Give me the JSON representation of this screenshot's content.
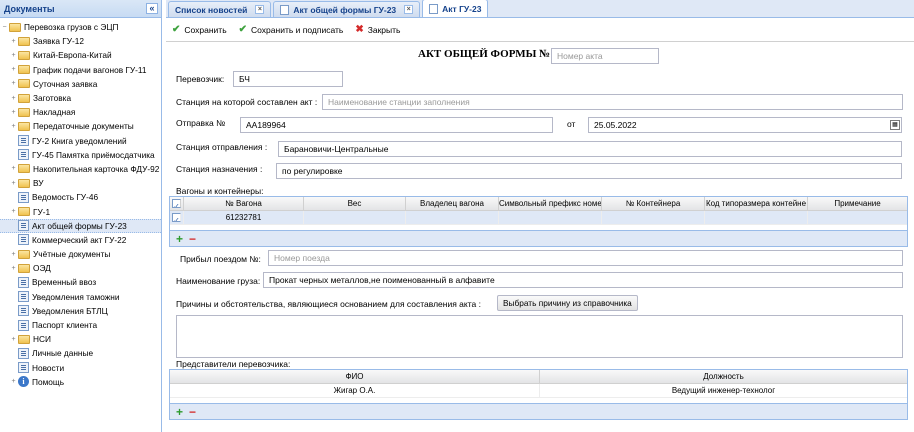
{
  "sidebar": {
    "title": "Документы",
    "collapse": "«",
    "root": "Перевозка грузов с ЭЦП",
    "items": [
      {
        "label": "Заявка ГУ-12",
        "icon": "folder",
        "exp": "+"
      },
      {
        "label": "Китай-Европа-Китай",
        "icon": "folder",
        "exp": "+"
      },
      {
        "label": "График подачи вагонов ГУ-11",
        "icon": "folder",
        "exp": "+"
      },
      {
        "label": "Суточная заявка",
        "icon": "folder",
        "exp": "+"
      },
      {
        "label": "Заготовка",
        "icon": "folder",
        "exp": "+"
      },
      {
        "label": "Накладная",
        "icon": "folder",
        "exp": "+"
      },
      {
        "label": "Передаточные документы",
        "icon": "folder",
        "exp": "+"
      },
      {
        "label": "ГУ-2 Книга уведомлений",
        "icon": "doc",
        "exp": ""
      },
      {
        "label": "ГУ-45 Памятка приёмосдатчика",
        "icon": "doc",
        "exp": ""
      },
      {
        "label": "Накопительная карточка ФДУ-92",
        "icon": "folder",
        "exp": "+"
      },
      {
        "label": "ВУ",
        "icon": "folder",
        "exp": "+"
      },
      {
        "label": "Ведомость ГУ-46",
        "icon": "doc",
        "exp": ""
      },
      {
        "label": "ГУ-1",
        "icon": "folder",
        "exp": "+"
      },
      {
        "label": "Акт общей формы ГУ-23",
        "icon": "doc",
        "exp": "",
        "selected": true
      },
      {
        "label": "Коммерческий акт ГУ-22",
        "icon": "doc",
        "exp": ""
      },
      {
        "label": "Учётные документы",
        "icon": "folder",
        "exp": "+"
      },
      {
        "label": "ОЭД",
        "icon": "folder",
        "exp": "+"
      },
      {
        "label": "Временный ввоз",
        "icon": "doc",
        "exp": ""
      },
      {
        "label": "Уведомления таможни",
        "icon": "doc",
        "exp": ""
      },
      {
        "label": "Уведомления БТЛЦ",
        "icon": "doc",
        "exp": ""
      },
      {
        "label": "Паспорт клиента",
        "icon": "doc",
        "exp": ""
      },
      {
        "label": "НСИ",
        "icon": "folder",
        "exp": "+"
      },
      {
        "label": "Личные данные",
        "icon": "doc",
        "exp": ""
      },
      {
        "label": "Новости",
        "icon": "doc",
        "exp": ""
      }
    ],
    "help": "Помощь"
  },
  "tabs": [
    {
      "label": "Список новостей",
      "active": false
    },
    {
      "label": "Акт общей формы ГУ-23",
      "active": false
    },
    {
      "label": "Акт ГУ-23",
      "active": true
    }
  ],
  "toolbar": {
    "save": "Сохранить",
    "save_sign": "Сохранить и подписать",
    "close": "Закрыть"
  },
  "form": {
    "title": "АКТ ОБЩЕЙ ФОРМЫ №",
    "act_number_placeholder": "Номер акта",
    "carrier_label": "Перевозчик:",
    "carrier_value": "БЧ",
    "station_made_label": "Станция на которой составлен акт :",
    "station_made_placeholder": "Наименование станции заполнения",
    "shipment_label": "Отправка №",
    "shipment_value": "АА189964",
    "from_label": "от",
    "date_value": "25.05.2022",
    "dep_station_label": "Станция отправления :",
    "dep_station_value": "Барановичи-Центральные",
    "dest_station_label": "Станция назначения :",
    "dest_station_value": "по регулировке",
    "wagons_label": "Вагоны и контейнеры:",
    "train_label": "Прибыл поездом №:",
    "train_placeholder": "Номер поезда",
    "cargo_label": "Наименование груза:",
    "cargo_value": "Прокат черных металлов,не поименованный в алфавите",
    "reasons_label": "Причины и обстоятельства, являющиеся основанием для составления акта :",
    "reasons_button": "Выбрать причину из справочника",
    "reps_label": "Представители перевозчика:"
  },
  "wagons_grid": {
    "headers": [
      "№ Вагона",
      "Вес",
      "Владелец вагона",
      "Символьный префикс номе",
      "№ Контейнера",
      "Код типоразмера контейне",
      "Примечание"
    ],
    "rows": [
      {
        "wagon": "61232781"
      }
    ]
  },
  "reps_grid": {
    "headers": [
      "ФИО",
      "Должность"
    ],
    "rows": [
      {
        "fio": "Жигар О.А.",
        "position": "Ведущий инженер-технолог"
      }
    ]
  },
  "add_symbol": "+",
  "remove_symbol": "−"
}
